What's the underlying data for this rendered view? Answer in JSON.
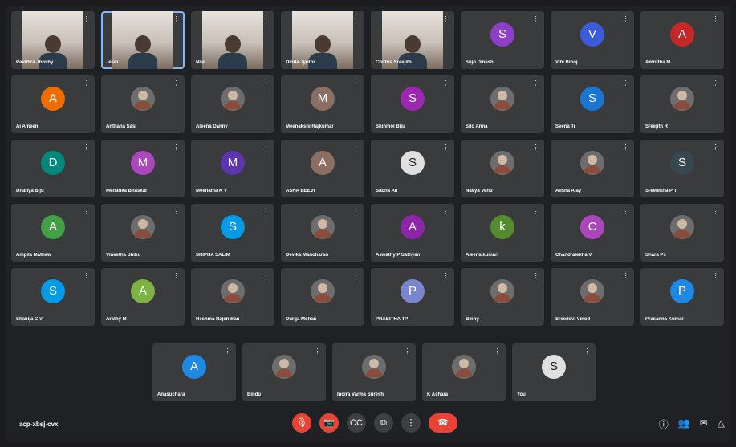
{
  "tiles": [
    {
      "name": "Pavithra Jhoshy",
      "kind": "video",
      "active": false
    },
    {
      "name": "Jesni",
      "kind": "video",
      "active": true
    },
    {
      "name": "Nija",
      "kind": "video",
      "active": false
    },
    {
      "name": "Dinda Jyothi",
      "kind": "video",
      "active": false
    },
    {
      "name": "Chithra Sreejith",
      "kind": "video",
      "active": false
    },
    {
      "name": "Sujo Dinesh",
      "kind": "avatar",
      "initial": "S",
      "color": "#8e3fc7"
    },
    {
      "name": "Vibi Binoj",
      "kind": "avatar",
      "initial": "V",
      "color": "#3b5bdb"
    },
    {
      "name": "Amrutha M",
      "kind": "avatar",
      "initial": "A",
      "color": "#c62828"
    },
    {
      "name": "Ai Ameen",
      "kind": "avatar",
      "initial": "A",
      "color": "#ef6c00"
    },
    {
      "name": "Anthana Sasi",
      "kind": "photo",
      "initial": "",
      "color": "#6d6d6d"
    },
    {
      "name": "Aleena Danny",
      "kind": "photo",
      "initial": "",
      "color": "#6d6d6d"
    },
    {
      "name": "Meenakshi Rajkumar",
      "kind": "avatar",
      "initial": "M",
      "color": "#8d6e63"
    },
    {
      "name": "Shinmol Biju",
      "kind": "avatar",
      "initial": "S",
      "color": "#9c27b0"
    },
    {
      "name": "Silo Anna",
      "kind": "photo",
      "initial": "",
      "color": "#6d6d6d"
    },
    {
      "name": "Seena Tr",
      "kind": "avatar",
      "initial": "S",
      "color": "#1976d2"
    },
    {
      "name": "Sreejith R",
      "kind": "photo",
      "initial": "",
      "color": "#6d6d6d"
    },
    {
      "name": "Dhanya Biju",
      "kind": "avatar",
      "initial": "D",
      "color": "#00897b"
    },
    {
      "name": "Meharika Bhaskar",
      "kind": "avatar",
      "initial": "M",
      "color": "#ab47bc"
    },
    {
      "name": "Meenama K V",
      "kind": "avatar",
      "initial": "M",
      "color": "#5e35b1"
    },
    {
      "name": "ASHA BEEVI",
      "kind": "avatar",
      "initial": "A",
      "color": "#8d6e63"
    },
    {
      "name": "Sabna Ali",
      "kind": "avatar",
      "initial": "S",
      "color": "#e0e0e0"
    },
    {
      "name": "Navya Venu",
      "kind": "photo",
      "initial": "",
      "color": "#6d6d6d"
    },
    {
      "name": "Alisha Ajay",
      "kind": "photo",
      "initial": "",
      "color": "#6d6d6d"
    },
    {
      "name": "Sreelekha P T",
      "kind": "avatar",
      "initial": "S",
      "color": "#37474f"
    },
    {
      "name": "Ampila Mathew",
      "kind": "avatar",
      "initial": "A",
      "color": "#43a047"
    },
    {
      "name": "Vineetha Shibu",
      "kind": "photo",
      "initial": "",
      "color": "#6d6d6d"
    },
    {
      "name": "SHIPHA SALIM",
      "kind": "avatar",
      "initial": "S",
      "color": "#039be5"
    },
    {
      "name": "Devika Manoharan",
      "kind": "photo",
      "initial": "",
      "color": "#6d6d6d"
    },
    {
      "name": "Aswathy P Sathyan",
      "kind": "avatar",
      "initial": "A",
      "color": "#8e24aa"
    },
    {
      "name": "Aleena kumari",
      "kind": "avatar",
      "initial": "k",
      "color": "#558b2f"
    },
    {
      "name": "Chandralekha V",
      "kind": "avatar",
      "initial": "C",
      "color": "#ab47bc"
    },
    {
      "name": "Shara Ps",
      "kind": "photo",
      "initial": "",
      "color": "#6d6d6d"
    },
    {
      "name": "Shabija C V",
      "kind": "avatar",
      "initial": "S",
      "color": "#039be5"
    },
    {
      "name": "Arathy M",
      "kind": "avatar",
      "initial": "A",
      "color": "#7cb342"
    },
    {
      "name": "Reshma Rajendran",
      "kind": "photo",
      "initial": "",
      "color": "#6d6d6d"
    },
    {
      "name": "Durga Mohan",
      "kind": "photo",
      "initial": "",
      "color": "#6d6d6d"
    },
    {
      "name": "PRABITHA TP",
      "kind": "avatar",
      "initial": "P",
      "color": "#7986cb"
    },
    {
      "name": "Binny",
      "kind": "photo",
      "initial": "",
      "color": "#6d6d6d"
    },
    {
      "name": "Sreedevi Vinod",
      "kind": "photo",
      "initial": "",
      "color": "#6d6d6d"
    },
    {
      "name": "Prasanna Kumar",
      "kind": "avatar",
      "initial": "P",
      "color": "#1e88e5"
    }
  ],
  "last_row": [
    {
      "name": "Anasuchara",
      "kind": "avatar",
      "initial": "A",
      "color": "#1e88e5"
    },
    {
      "name": "Bindu",
      "kind": "photo",
      "initial": "",
      "color": "#6d6d6d"
    },
    {
      "name": "Indira Varma Suresh",
      "kind": "photo",
      "initial": "",
      "color": "#6d6d6d"
    },
    {
      "name": "K Ashara",
      "kind": "photo",
      "initial": "",
      "color": "#6d6d6d"
    },
    {
      "name": "You",
      "kind": "avatar",
      "initial": "S",
      "color": "#e0e0e0"
    }
  ],
  "footer": {
    "meeting_code": "acp-xbsj-cvx"
  }
}
